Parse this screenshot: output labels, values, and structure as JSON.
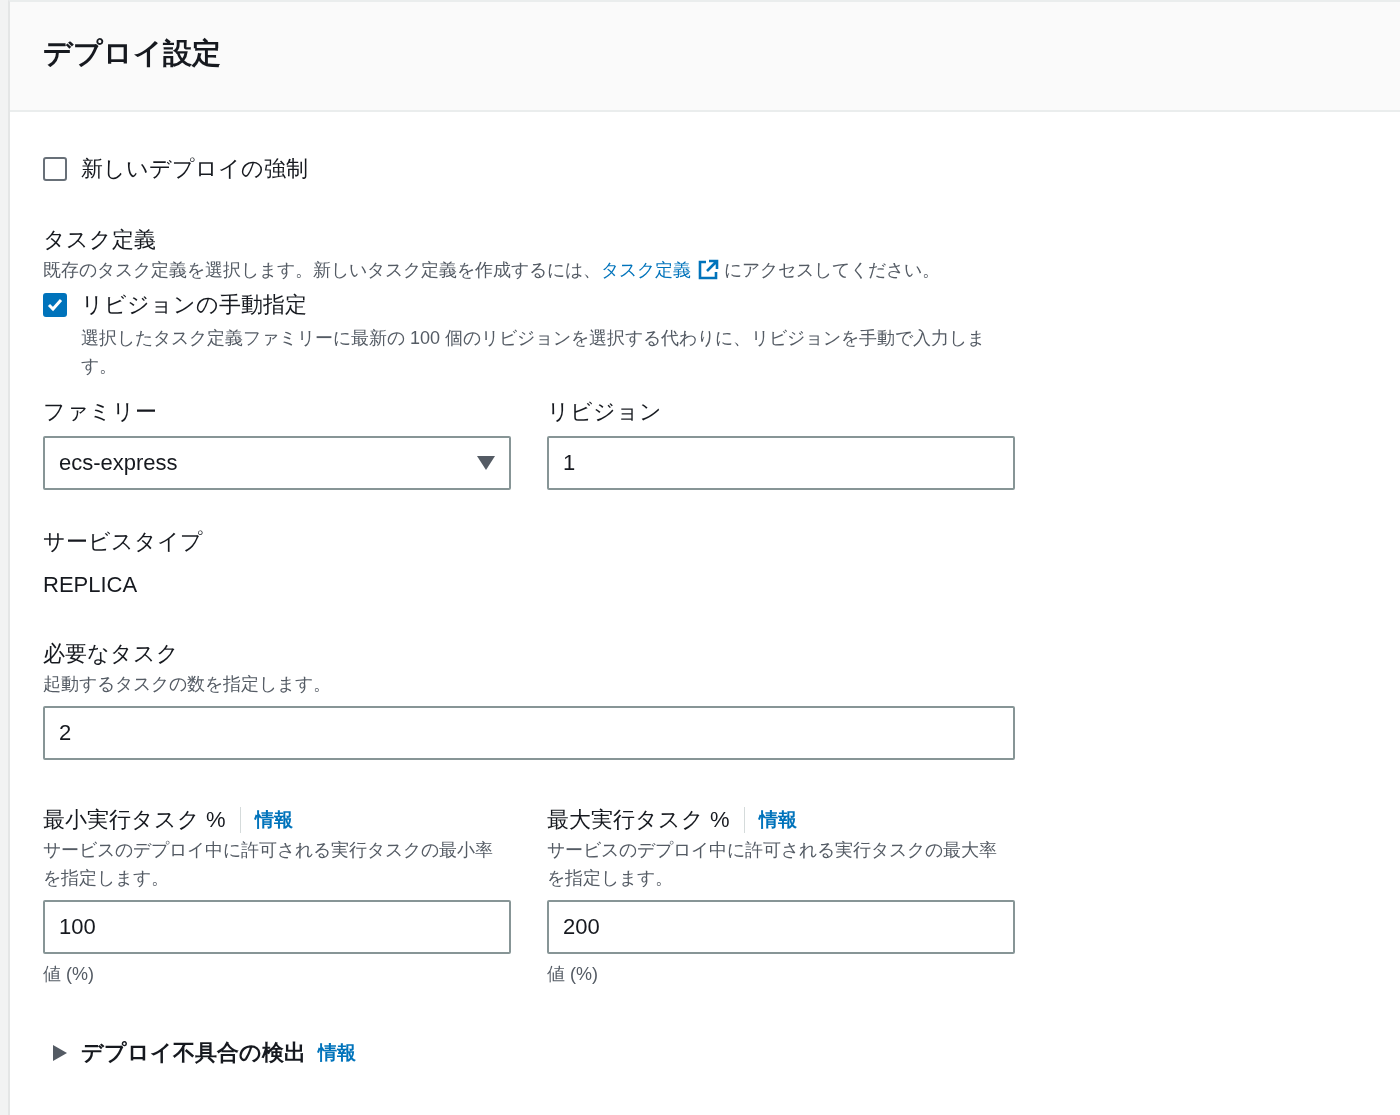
{
  "header": {
    "title": "デプロイ設定"
  },
  "force_new_deployment": {
    "label": "新しいデプロイの強制",
    "checked": false
  },
  "task_definition": {
    "label": "タスク定義",
    "description_before": "既存のタスク定義を選択します。新しいタスク定義を作成するには、",
    "link": "タスク定義",
    "description_after": "にアクセスしてください。"
  },
  "manual_revision": {
    "label": "リビジョンの手動指定",
    "checked": true,
    "description": "選択したタスク定義ファミリーに最新の 100 個のリビジョンを選択する代わりに、リビジョンを手動で入力します。"
  },
  "family": {
    "label": "ファミリー",
    "value": "ecs-express"
  },
  "revision": {
    "label": "リビジョン",
    "value": "1"
  },
  "service_type": {
    "label": "サービスタイプ",
    "value": "REPLICA"
  },
  "desired_tasks": {
    "label": "必要なタスク",
    "description": "起動するタスクの数を指定します。",
    "value": "2"
  },
  "percent_fields": [
    {
      "label": "最小実行タスク %",
      "info": "情報",
      "description": "サービスのデプロイ中に許可される実行タスクの最小率を指定します。",
      "value": "100",
      "constraint": "値 (%)"
    },
    {
      "label": "最大実行タスク %",
      "info": "情報",
      "description": "サービスのデプロイ中に許可される実行タスクの最大率を指定します。",
      "value": "200",
      "constraint": "値 (%)"
    }
  ],
  "expandable": {
    "label": "デプロイ不具合の検出",
    "info": "情報",
    "expanded": false
  }
}
